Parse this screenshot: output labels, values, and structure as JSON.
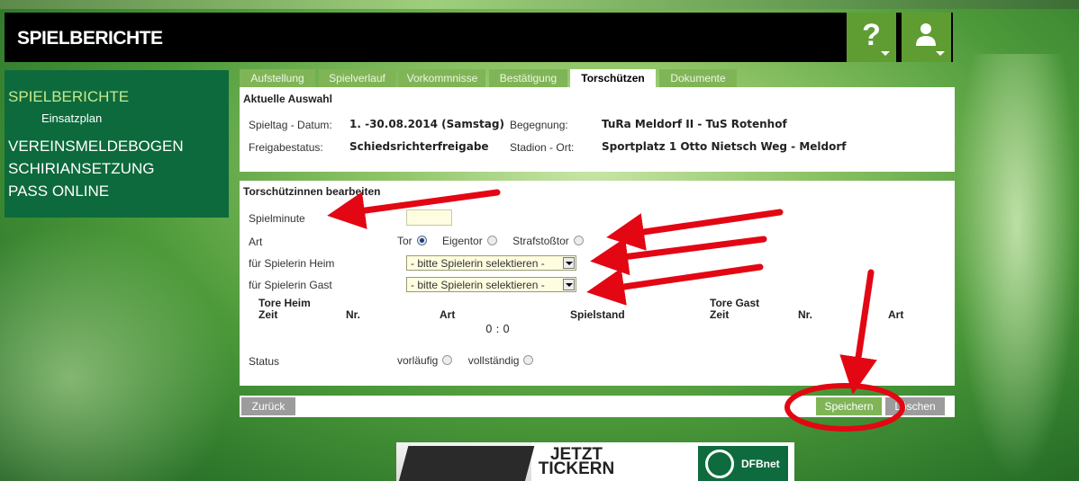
{
  "header": {
    "title": "SPIELBERICHTE",
    "help_glyph": "?",
    "help_icon": "question-icon",
    "user_icon": "user-icon"
  },
  "sidebar": {
    "items": [
      {
        "label": "SPIELBERICHTE"
      },
      {
        "label": "Einsatzplan"
      },
      {
        "label": "VEREINSMELDEBOGEN"
      },
      {
        "label": "SCHIRIANSETZUNG"
      },
      {
        "label": "PASS ONLINE"
      }
    ]
  },
  "tabs": [
    "Aufstellung",
    "Spielverlauf",
    "Vorkommnisse",
    "Bestätigung",
    "Torschützen",
    "Dokumente"
  ],
  "selection": {
    "heading": "Aktuelle Auswahl",
    "spieltag_label": "Spieltag - Datum:",
    "spieltag_value": "1. -30.08.2014 (Samstag)",
    "begegnung_label": "Begegnung:",
    "begegnung_value": "TuRa Meldorf II - TuS Rotenhof",
    "freigabe_label": "Freigabestatus:",
    "freigabe_value": "Schiedsrichterfreigabe",
    "stadion_label": "Stadion - Ort:",
    "stadion_value": "Sportplatz 1 Otto Nietsch Weg - Meldorf"
  },
  "form": {
    "heading": "Torschützinnen bearbeiten",
    "spielminute_label": "Spielminute",
    "spielminute_value": "",
    "art_label": "Art",
    "art_options": [
      "Tor",
      "Eigentor",
      "Strafstoßtor"
    ],
    "art_selected": "Tor",
    "heim_label": "für Spielerin Heim",
    "heim_select": "- bitte Spielerin selektieren -",
    "gast_label": "für Spielerin Gast",
    "gast_select": "- bitte Spielerin selektieren -",
    "tore_heim": "Tore Heim",
    "tore_gast": "Tore Gast",
    "col_zeit": "Zeit",
    "col_nr": "Nr.",
    "col_art": "Art",
    "col_spielstand": "Spielstand",
    "score": "0 : 0",
    "status_label": "Status",
    "status_options": [
      "vorläufig",
      "vollständig"
    ]
  },
  "footer": {
    "back": "Zurück",
    "save": "Speichern",
    "delete": "Löschen"
  },
  "banner": {
    "line1": "JETZT",
    "line2": "TICKERN",
    "brand": "DFBnet"
  },
  "colors": {
    "accent": "#80b557",
    "sidebar": "#0d6a3d",
    "annotation": "#e30613"
  }
}
